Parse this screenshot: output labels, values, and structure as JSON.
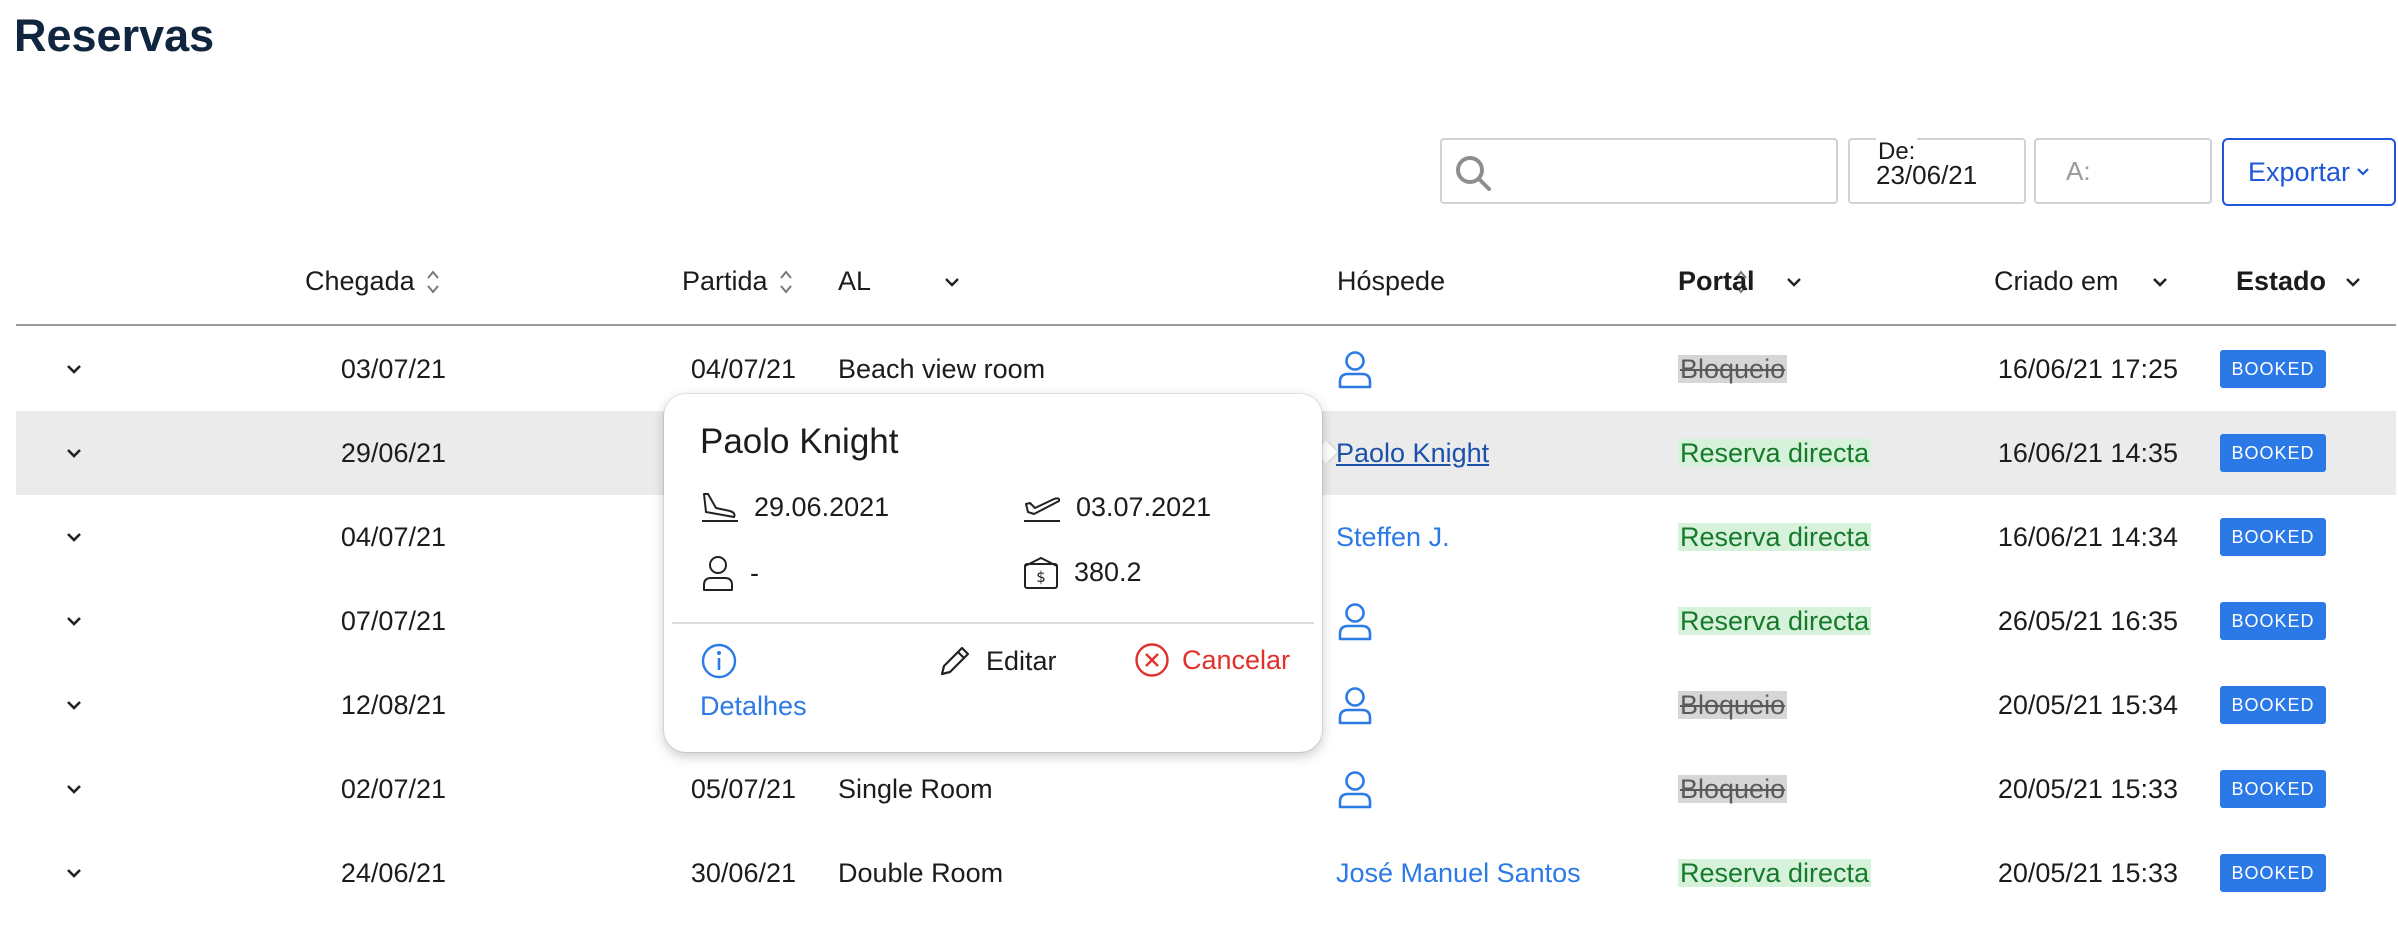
{
  "page": {
    "title": "Reservas"
  },
  "toolbar": {
    "search_value": "",
    "date_from": {
      "label": "De:",
      "value": "23/06/21"
    },
    "date_to": {
      "placeholder": "A:"
    },
    "export_label": "Exportar"
  },
  "table": {
    "columns": {
      "arrival": "Chegada",
      "departure": "Partida",
      "al": "AL",
      "guest": "Hóspede",
      "portal": "Portal",
      "created": "Criado em",
      "state": "Estado"
    },
    "rows": [
      {
        "arrival": "03/07/21",
        "departure": "04/07/21",
        "al": "Beach view room",
        "guest": "",
        "portal": "Bloqueio",
        "created": "16/06/21 17:25",
        "state": "BOOKED"
      },
      {
        "arrival": "29/06/21",
        "departure": "",
        "al": "",
        "guest": "Paolo Knight",
        "portal": "Reserva directa",
        "created": "16/06/21 14:35",
        "state": "BOOKED"
      },
      {
        "arrival": "04/07/21",
        "departure": "",
        "al": "",
        "guest": "Steffen J.",
        "portal": "Reserva directa",
        "created": "16/06/21 14:34",
        "state": "BOOKED"
      },
      {
        "arrival": "07/07/21",
        "departure": "",
        "al": "",
        "guest": "",
        "portal": "Reserva directa",
        "created": "26/05/21 16:35",
        "state": "BOOKED"
      },
      {
        "arrival": "12/08/21",
        "departure": "",
        "al": "",
        "guest": "",
        "portal": "Bloqueio",
        "created": "20/05/21 15:34",
        "state": "BOOKED"
      },
      {
        "arrival": "02/07/21",
        "departure": "05/07/21",
        "al": "Single Room",
        "guest": "",
        "portal": "Bloqueio",
        "created": "20/05/21 15:33",
        "state": "BOOKED"
      },
      {
        "arrival": "24/06/21",
        "departure": "30/06/21",
        "al": "Double Room",
        "guest": "José Manuel Santos",
        "portal": "Reserva directa",
        "created": "20/05/21 15:33",
        "state": "BOOKED"
      }
    ]
  },
  "popover": {
    "guest_name": "Paolo Knight",
    "arrival": "29.06.2021",
    "departure": "03.07.2021",
    "guests": "-",
    "amount": "380.2",
    "details_label": "Detalhes",
    "edit_label": "Editar",
    "cancel_label": "Cancelar"
  },
  "colors": {
    "accent": "#2a79e6",
    "export_border": "#1f57d6",
    "portal_direct_bg": "#d7f2da",
    "portal_block_bg": "#d6d6d6",
    "cancel": "#e0312c",
    "row_highlight": "#ebebeb"
  },
  "icons": {
    "search": "search-icon",
    "sort": "sort-icon",
    "dropdown": "chevron-down-icon",
    "expand": "chevron-down-icon",
    "guest": "person-icon",
    "arrival": "plane-landing-icon",
    "departure": "plane-takeoff-icon",
    "money": "money-icon",
    "info": "info-icon",
    "edit": "pencil-icon",
    "cancel": "close-circle-icon"
  }
}
